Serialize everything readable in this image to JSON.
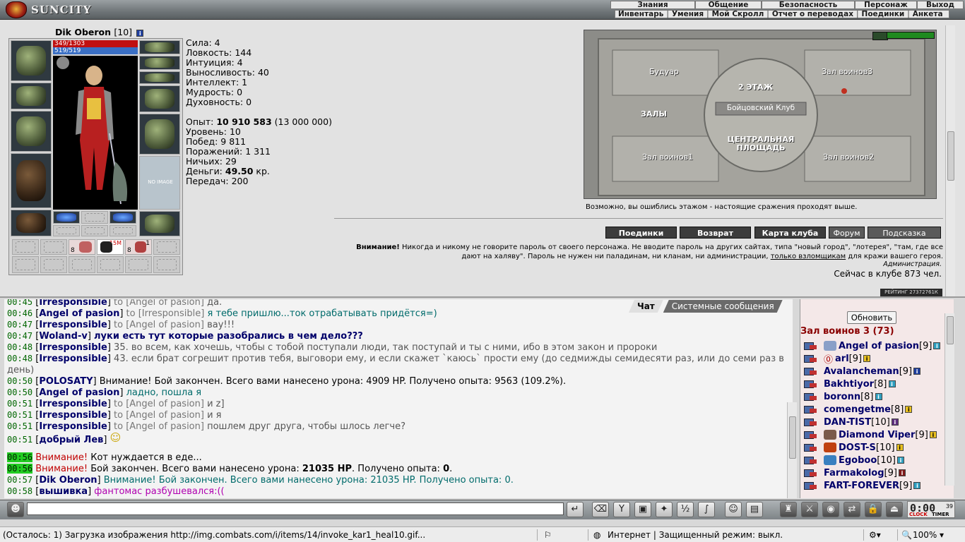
{
  "app": {
    "logo_text": "SUNCITY"
  },
  "menu_top": [
    "Знания",
    "Общение",
    "Безопасность",
    "Персонаж",
    "Выход"
  ],
  "menu_sub": [
    "Инвентарь",
    "Умения",
    "Мой Скролл",
    "Отчет о переводах",
    "Поединки",
    "Анкета"
  ],
  "character": {
    "name": "Dik Oberon",
    "level": "[10]",
    "hp": "349/1303",
    "mana": "519/519",
    "avatar_noimage": "NO IMAGE",
    "belt_labels": [
      "8",
      "15М",
      "8",
      "1"
    ]
  },
  "stats": {
    "strength": "Сила: 4",
    "agility": "Ловкость: 144",
    "intuition": "Интуиция: 4",
    "endurance": "Выносливость: 40",
    "intellect": "Интеллект: 1",
    "wisdom": "Мудрость: 0",
    "spirit": "Духовность: 0",
    "exp_label": "Опыт: ",
    "exp_value": "10 910 583",
    "exp_next": " (13 000 000)",
    "level": "Уровень: 10",
    "wins": "Побед: 9 811",
    "losses": "Поражений: 1 311",
    "draws": "Ничьих: 29",
    "money_label": "Деньги: ",
    "money_value": "49.50",
    "money_unit": " кр.",
    "transfers": "Передач: 200"
  },
  "map": {
    "rooms": [
      "Будуар",
      "Зал воинов3",
      "2 ЭТАЖ",
      "Бойцовский Клуб",
      "ЗАЛЫ",
      "ЦЕНТРАЛЬНАЯ",
      "ПЛОЩАДЬ",
      "Зал воинов1",
      "Зал воинов2"
    ],
    "note": "Возможно, вы ошиблись этажом - настоящие сражения проходят выше."
  },
  "buttons": [
    "Поединки",
    "Возврат",
    "Карта клуба",
    "Форум",
    "Подсказка"
  ],
  "warning": {
    "bold": "Внимание!",
    "text1": " Никогда и никому не говорите пароль от своего персонажа. Не вводите пароль на других сайтах, типа \"новый город\", \"лотерея\", \"там, где все дают на халяву\". Пароль не нужен ни паладинам, ни кланам, ни администрации, ",
    "link": "только взломщикам",
    "text2": " для кражи вашего героя.",
    "admin": "Администрация.",
    "online": "Сейчас в клубе 873 чел.",
    "rating": "РЕЙТИНГ 27372761К"
  },
  "chat_tabs": [
    "Чат",
    "Системные сообщения"
  ],
  "chat": [
    {
      "time": "00:45",
      "nick": "Irresponsible",
      "to": " to [Angel of pasion] ",
      "msg": "да.",
      "cls": "gray"
    },
    {
      "time": "00:46",
      "nick": "Angel of pasion",
      "to": " to [Irresponsible] ",
      "msg": "я тебе пришлю...ток отрабатывать придётся=)",
      "cls": "teal"
    },
    {
      "time": "00:47",
      "nick": "Irresponsible",
      "to": " to [Angel of pasion] ",
      "msg": "вау!!!",
      "cls": "gray"
    },
    {
      "time": "00:47",
      "nick": "Woland-v",
      "to": " ",
      "msg": "луки есть тут которые разобрались в чем дело???",
      "cls": "nick2"
    },
    {
      "time": "00:48",
      "nick": "Irresponsible",
      "to": " ",
      "msg": "35. во всем, как хочешь, чтобы с тобой поступали люди, так поступай и ты с ними, ибо в этом закон и пророки",
      "cls": "gray"
    },
    {
      "time": "00:48",
      "nick": "Irresponsible",
      "to": " ",
      "msg": "43. если брат согрешит против тебя, выговори ему, и если скажет `каюсь` прости ему (до седмижды семидесяти раз, или до семи раз в день)",
      "cls": "gray"
    },
    {
      "time": "00:50",
      "nick": "POLOSATY",
      "to": " ",
      "msg": "Внимание! Бой закончен. Всего вами нанесено урона: 4909 HP. Получено опыта: 9563 (109.2%).",
      "cls": "black"
    },
    {
      "time": "00:50",
      "nick": "Angel of pasion",
      "to": " ",
      "msg": "ладно, пошла я",
      "cls": "teal"
    },
    {
      "time": "00:51",
      "nick": "Irresponsible",
      "to": " to [Angel of pasion] ",
      "msg": "и z]",
      "cls": "gray"
    },
    {
      "time": "00:51",
      "nick": "Irresponsible",
      "to": " to [Angel of pasion] ",
      "msg": "и я",
      "cls": "gray"
    },
    {
      "time": "00:51",
      "nick": "Irresponsible",
      "to": " to [Angel of pasion] ",
      "msg": "пошлем друг друга, чтобы шлось легче?",
      "cls": "gray"
    },
    {
      "time": "00:51",
      "nick": "добрый Лев",
      "to": " ",
      "msg": "",
      "cls": "black"
    },
    {
      "time": "00:56",
      "sys": "Внимание!",
      "msg": " Кот нуждается в еде..."
    },
    {
      "time": "00:56",
      "sys": "Внимание!",
      "msg": " Бой закончен. Всего вами нанесено урона: ",
      "b1": "21035 HP",
      "msg2": ". Получено опыта: ",
      "b2": "0",
      "msg3": "."
    },
    {
      "time": "00:57",
      "nick": "Dik Oberon",
      "to": " ",
      "msg": "Внимание! Бой закончен. Всего вами нанесено урона: 21035 HP. Получено опыта: 0.",
      "cls": "teal"
    },
    {
      "time": "00:58",
      "nick": "вышивка",
      "to": " ",
      "msg": "фантомас разбушевался:((",
      "cls": "mag"
    }
  ],
  "users": {
    "refresh": "Обновить",
    "room": "Зал воинов 3 (73)",
    "list": [
      {
        "name": "Angel of pasion",
        "level": "[9]",
        "inf": "c"
      },
      {
        "name": "arl",
        "level": "[9]",
        "inf": "y"
      },
      {
        "name": "Avalancheman",
        "level": "[9]",
        "inf": "b"
      },
      {
        "name": "Bakhtiyor",
        "level": "[8]",
        "inf": "c"
      },
      {
        "name": "boronn",
        "level": "[8]",
        "inf": "c"
      },
      {
        "name": "comengetme",
        "level": "[8]",
        "inf": "y"
      },
      {
        "name": "DAN-TIST",
        "level": "[10]",
        "inf": "p"
      },
      {
        "name": "Diamond Viper",
        "level": "[9]",
        "inf": "y"
      },
      {
        "name": "DOST-S",
        "level": "[10]",
        "inf": "y"
      },
      {
        "name": "Egoboo",
        "level": "[10]",
        "inf": "c"
      },
      {
        "name": "Farmakolog",
        "level": "[9]",
        "inf": "r"
      },
      {
        "name": "FART-FOREVER",
        "level": "[9]",
        "inf": "c"
      }
    ]
  },
  "chat_input": {
    "value": ""
  },
  "clock": {
    "time": "0:00",
    "sec": "39",
    "label1": "CLOCK",
    "label2": "TIMER"
  },
  "statusbar": {
    "loading": "(Осталось: 1) Загрузка изображения http://img.combats.com/i/items/14/invoke_kar1_heal10.gif...",
    "zone": "Интернет | Защищенный режим: выкл.",
    "zoom": "100%"
  },
  "colors": {
    "hp": "#c01010",
    "mana": "#3a6fc4",
    "room_title": "#8a0000",
    "nick": "#00006a"
  }
}
